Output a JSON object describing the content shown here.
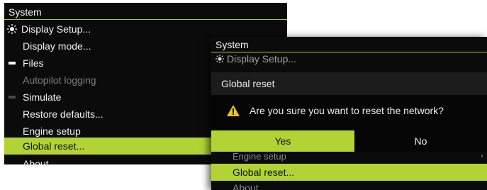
{
  "colors": {
    "accent": "#b3d334",
    "warning": "#f2c21b",
    "background": "#0b0b0b"
  },
  "left_panel": {
    "title": "System",
    "items": [
      {
        "label": "Display Setup...",
        "icon": "sun-icon",
        "state": "normal"
      },
      {
        "label": "Display mode...",
        "icon": "",
        "state": "normal"
      },
      {
        "label": "Files",
        "icon": "dash-icon",
        "state": "normal"
      },
      {
        "label": "Autopilot logging",
        "icon": "",
        "state": "disabled"
      },
      {
        "label": "Simulate",
        "icon": "dash-icon",
        "state": "normal"
      },
      {
        "label": "Restore defaults...",
        "icon": "",
        "state": "normal"
      },
      {
        "label": "Engine setup",
        "icon": "",
        "state": "normal"
      },
      {
        "label": "Global reset...",
        "icon": "",
        "state": "selected"
      },
      {
        "label": "About",
        "icon": "",
        "state": "normal"
      }
    ]
  },
  "right_panel": {
    "title": "System",
    "top_item": "Display Setup...",
    "dialog": {
      "title": "Global reset",
      "message": "Are you sure you want to reset the network?",
      "yes_label": "Yes",
      "no_label": "No"
    },
    "below_items": [
      "Engine setup",
      "Global reset...",
      "About"
    ]
  }
}
